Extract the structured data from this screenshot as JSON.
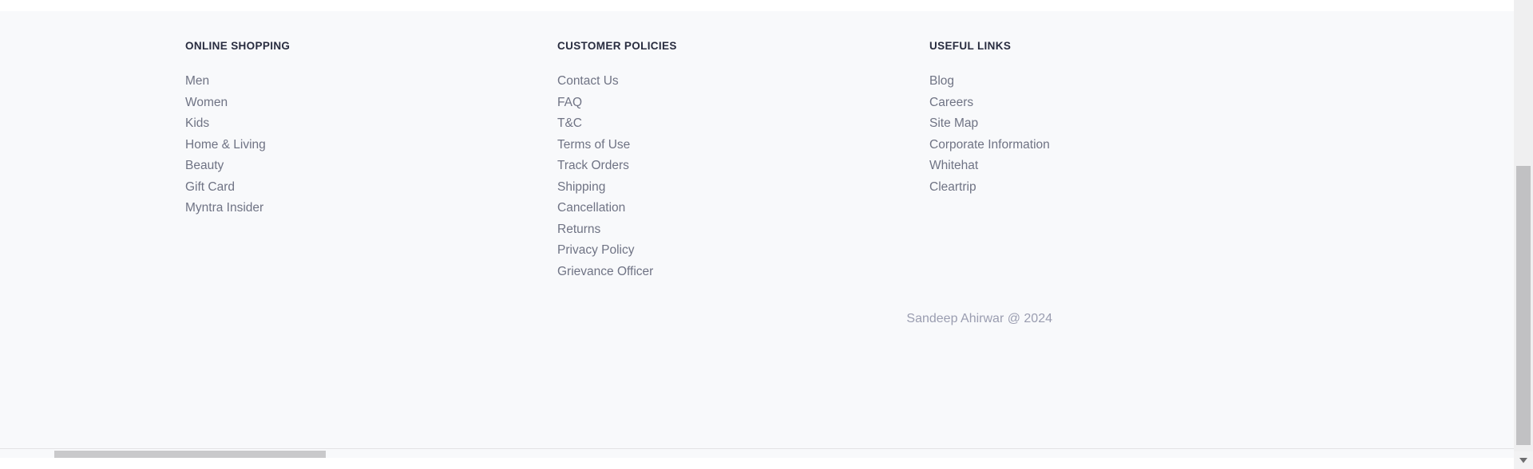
{
  "theme": {
    "page_background": "#f8f9fb",
    "heading_color": "#282c3f",
    "link_color": "#6f7384",
    "copyright_color": "#9a9db0",
    "scrollbar_track": "#efeff0",
    "scrollbar_thumb": "#c1c1c3"
  },
  "footer": {
    "columns": [
      {
        "heading": "ONLINE SHOPPING",
        "links": [
          "Men",
          "Women",
          "Kids",
          "Home & Living",
          "Beauty",
          "Gift Card",
          "Myntra Insider"
        ]
      },
      {
        "heading": "CUSTOMER POLICIES",
        "links": [
          "Contact Us",
          "FAQ",
          "T&C",
          "Terms of Use",
          "Track Orders",
          "Shipping",
          "Cancellation",
          "Returns",
          "Privacy Policy",
          "Grievance Officer"
        ]
      },
      {
        "heading": "USEFUL LINKS",
        "links": [
          "Blog",
          "Careers",
          "Site Map",
          "Corporate Information",
          "Whitehat",
          "Cleartrip"
        ]
      }
    ],
    "copyright": "Sandeep Ahirwar @ 2024"
  },
  "scrollbars": {
    "vertical_down_arrow_icon": "chevron-down-icon",
    "vertical_position_percent": 62,
    "horizontal_position_percent": 4
  }
}
